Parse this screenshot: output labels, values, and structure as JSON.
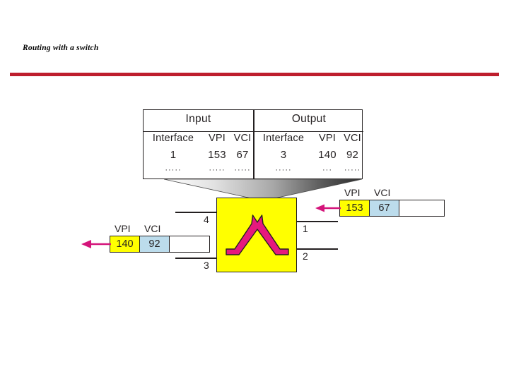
{
  "slide": {
    "title": "Routing with a switch",
    "rule_color": "#be1e2d"
  },
  "colors": {
    "switch_fill": "#ffff00",
    "vpi_fill": "#ffff00",
    "vci_fill": "#bcdcec",
    "arrow": "#d4147a",
    "glyph": "#e6197d",
    "outline": "#231f20",
    "rule": "#be1e2d"
  },
  "routing_table": {
    "groups": {
      "input": "Input",
      "output": "Output"
    },
    "headers": [
      "Interface",
      "VPI",
      "VCI",
      "Interface",
      "VPI",
      "VCI"
    ],
    "rows": [
      [
        "1",
        "153",
        "67",
        "3",
        "140",
        "92"
      ],
      [
        "·····",
        "·····",
        "·····",
        "·····",
        "···",
        "·····"
      ]
    ]
  },
  "switch": {
    "interfaces": {
      "left_top": "4",
      "left_bottom": "3",
      "right_top": "1",
      "right_bottom": "2"
    }
  },
  "incoming_cell": {
    "vpi_label": "VPI",
    "vci_label": "VCI",
    "vpi_value": "153",
    "vci_value": "67"
  },
  "outgoing_cell": {
    "vpi_label": "VPI",
    "vci_label": "VCI",
    "vpi_value": "140",
    "vci_value": "92"
  }
}
